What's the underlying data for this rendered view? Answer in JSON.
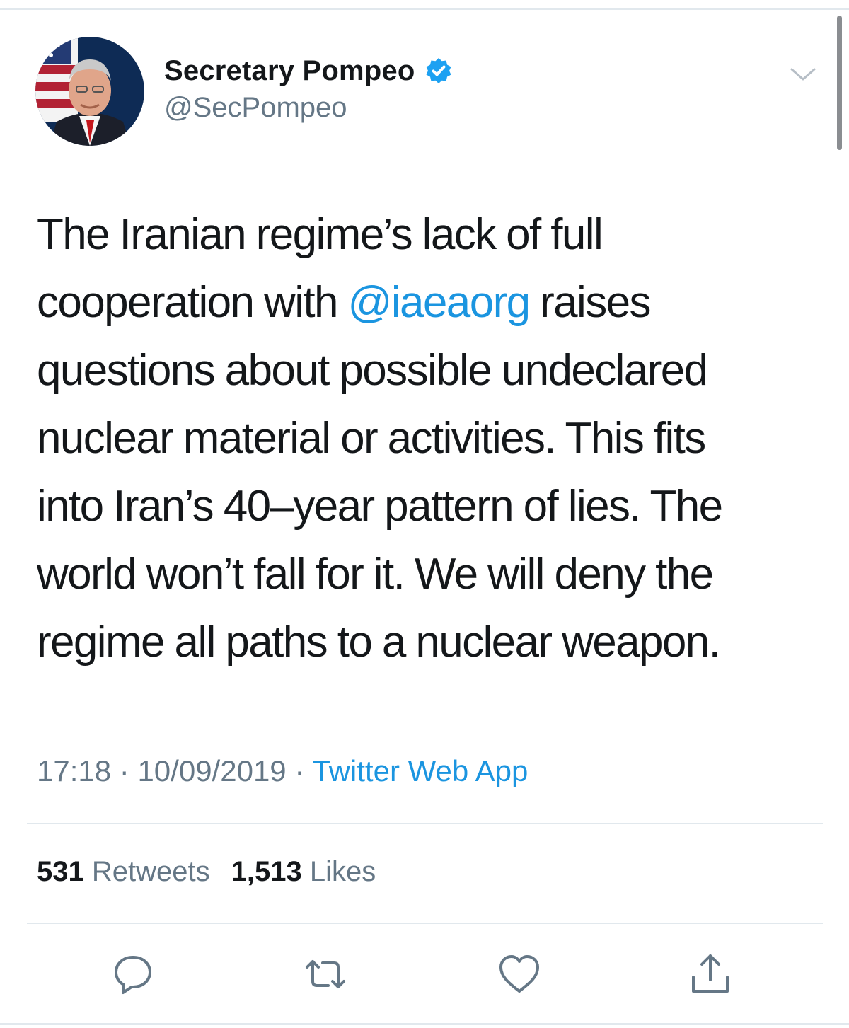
{
  "author": {
    "display_name": "Secretary Pompeo",
    "handle": "@SecPompeo",
    "verified": true,
    "avatar_icon": "profile-photo"
  },
  "tweet": {
    "lines": [
      {
        "before": "The Iranian regime’s lack of full",
        "mention": "",
        "after": ""
      },
      {
        "before": "cooperation with ",
        "mention": "@iaeaorg",
        "after": " raises"
      },
      {
        "before": "questions about possible undeclared",
        "mention": "",
        "after": ""
      },
      {
        "before": "nuclear material or activities. This fits",
        "mention": "",
        "after": ""
      },
      {
        "before": "into Iran’s 40–year pattern of lies. The",
        "mention": "",
        "after": ""
      },
      {
        "before": "world won’t fall for it. We will deny the",
        "mention": "",
        "after": ""
      },
      {
        "before": "regime all paths to a nuclear weapon.",
        "mention": "",
        "after": ""
      }
    ]
  },
  "meta": {
    "time": "17:18",
    "separator": "·",
    "date": "10/09/2019",
    "source": "Twitter Web App"
  },
  "stats": {
    "retweets_count": "531",
    "retweets_label": "Retweets",
    "likes_count": "1,513",
    "likes_label": "Likes"
  },
  "actions": [
    {
      "icon": "reply-icon"
    },
    {
      "icon": "retweet-icon"
    },
    {
      "icon": "like-icon"
    },
    {
      "icon": "share-icon"
    }
  ],
  "colors": {
    "link": "#1b95e0",
    "secondary_text": "#657786",
    "primary_text": "#14171a",
    "divider": "#e1e8ed",
    "verified_badge": "#1da1f2"
  }
}
